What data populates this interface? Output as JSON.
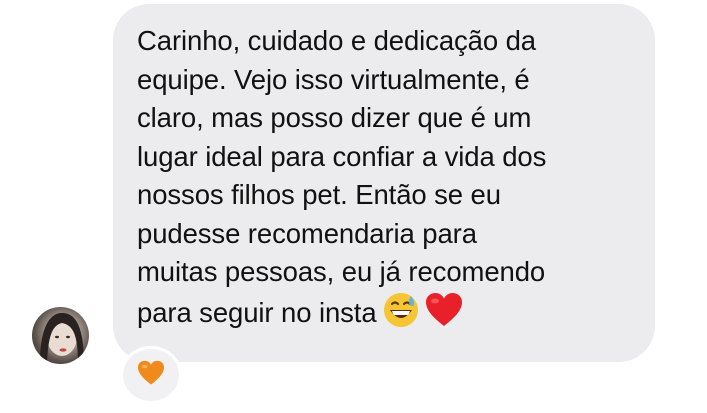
{
  "message": {
    "lines": [
      "Carinho, cuidado e dedicação da",
      "equipe. Vejo isso virtualmente, é",
      "claro, mas posso dizer que é um",
      "lugar ideal para confiar a vida dos",
      "nossos filhos pet. Então se eu",
      "pudesse recomendaria para",
      "muitas pessoas, eu já recomendo",
      "para seguir no insta"
    ],
    "trailing_emojis": [
      "grinning-sweat-emoji",
      "red-heart-emoji"
    ]
  },
  "reaction": {
    "emoji": "orange-heart-emoji",
    "color": "#f08a1c"
  },
  "colors": {
    "bubble": "#ececee",
    "text": "#111111",
    "heart_red": "#e8202a",
    "smiley_yellow": "#f6c533"
  }
}
